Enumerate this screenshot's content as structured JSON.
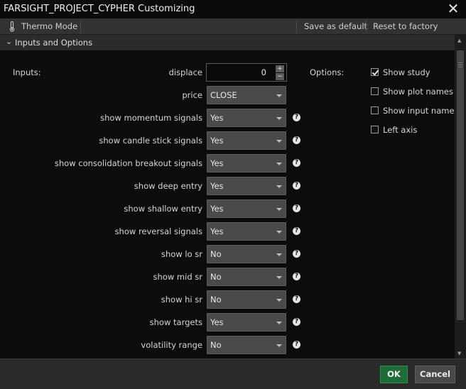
{
  "window": {
    "title": "FARSIGHT_PROJECT_CYPHER Customizing",
    "close_glyph": "✕",
    "close_icon": "close-icon"
  },
  "toolbar": {
    "thermo_icon": "thermometer-icon",
    "thermo_label": "Thermo Mode",
    "save_default_label": "Save as default",
    "reset_label": "Reset to factory default"
  },
  "section": {
    "chevron": "⌄",
    "chevron_icon": "chevron-down-icon",
    "label": "Inputs and Options"
  },
  "inputs_label": "Inputs:",
  "options_label": "Options:",
  "displace": {
    "label": "displace",
    "value": "0",
    "up": "+",
    "down": "−"
  },
  "price": {
    "label": "price",
    "value": "CLOSE"
  },
  "settings": [
    {
      "label": "show momentum signals",
      "value": "Yes"
    },
    {
      "label": "show candle stick signals",
      "value": "Yes"
    },
    {
      "label": "show consolidation breakout signals",
      "value": "Yes"
    },
    {
      "label": "show deep entry",
      "value": "Yes"
    },
    {
      "label": "show shallow entry",
      "value": "Yes"
    },
    {
      "label": "show reversal signals",
      "value": "Yes"
    },
    {
      "label": "show lo sr",
      "value": "No"
    },
    {
      "label": "show mid sr",
      "value": "No"
    },
    {
      "label": "show hi sr",
      "value": "No"
    },
    {
      "label": "show targets",
      "value": "Yes"
    },
    {
      "label": "volatility range",
      "value": "No"
    }
  ],
  "help_glyph": "?",
  "options": [
    {
      "label": "Show study",
      "checked": true
    },
    {
      "label": "Show plot names",
      "checked": false
    },
    {
      "label": "Show input names",
      "checked": false
    },
    {
      "label": "Left axis",
      "checked": false
    }
  ],
  "footer": {
    "ok_label": "OK",
    "cancel_label": "Cancel"
  },
  "colors": {
    "ok_button": "#1f6b3a",
    "dropdown": "#4a4a4a",
    "background": "#0c0c0c"
  }
}
